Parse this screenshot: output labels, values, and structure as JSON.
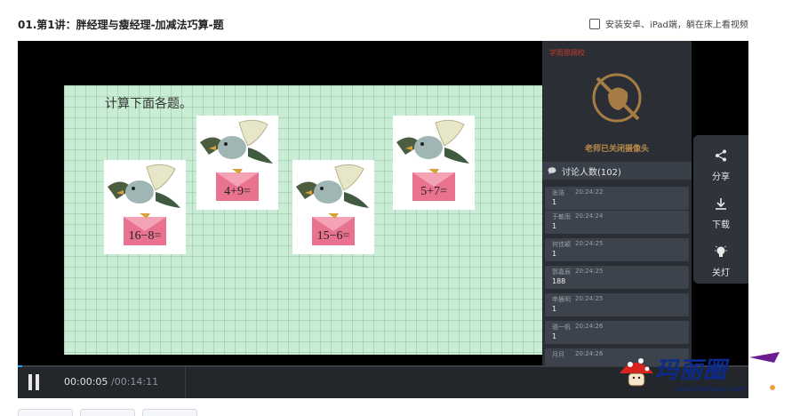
{
  "header": {
    "course_title": "01.第1讲：胖经理与瘦经理-加减法巧算-题",
    "ipad_option_label": "安装安卓、iPad端，躺在床上看视频"
  },
  "slide": {
    "heading": "计算下面各题。",
    "cards": [
      {
        "equation": "16−8="
      },
      {
        "equation": "4+9="
      },
      {
        "equation": "15−6="
      },
      {
        "equation": "5+7="
      }
    ]
  },
  "side_panel": {
    "school_label": "学而思网校",
    "camera_off_text": "老师已关闭摄像头",
    "chat_count_label": "讨论人数(102)",
    "messages": [
      {
        "name": "张浩",
        "time": "20:24:22",
        "text": "1"
      },
      {
        "name": "于敏雨",
        "time": "20:24:24",
        "text": "1"
      },
      {
        "name": "何佳颖",
        "time": "20:24:25",
        "text": "1"
      },
      {
        "name": "郭嘉辰",
        "time": "20:24:25",
        "text": "188"
      },
      {
        "name": "申晨明",
        "time": "20:24:25",
        "text": "1"
      },
      {
        "name": "骆一帆",
        "time": "20:24:26",
        "text": "1"
      },
      {
        "name": "月月",
        "time": "20:24:26",
        "text": ""
      }
    ]
  },
  "tools": {
    "share_label": "分享",
    "download_label": "下载",
    "light_off_label": "关灯"
  },
  "controls": {
    "current_time": "00:00:05",
    "total_time": "/00:14:11",
    "progress_fraction": 0.006
  },
  "watermark": {
    "logo_text": "玛丽圈",
    "url_text": "www.maliquan.com"
  },
  "colors": {
    "accent": "#1aa7f0",
    "slide_bg": "#c9ecd4",
    "panel_bg": "#2b2f35",
    "envelope": "#e9728f"
  }
}
